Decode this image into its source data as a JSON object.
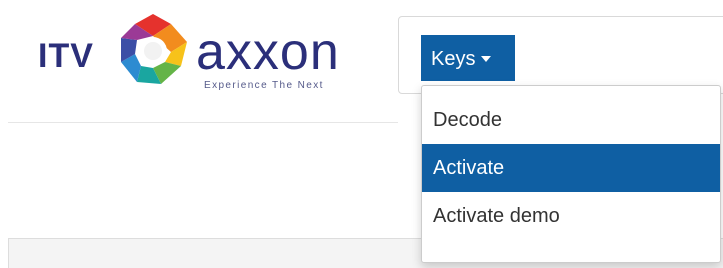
{
  "logo": {
    "brand_left": "ITV",
    "brand_right": "axxon",
    "tagline": "Experience The Next"
  },
  "nav": {
    "keys_button_label": "Keys"
  },
  "dropdown": {
    "items": [
      {
        "label": "Decode",
        "active": false
      },
      {
        "label": "Activate",
        "active": true
      },
      {
        "label": "Activate demo",
        "active": false
      }
    ]
  },
  "colors": {
    "accent": "#0f5fa3",
    "logo_text": "#2b2f7a"
  }
}
